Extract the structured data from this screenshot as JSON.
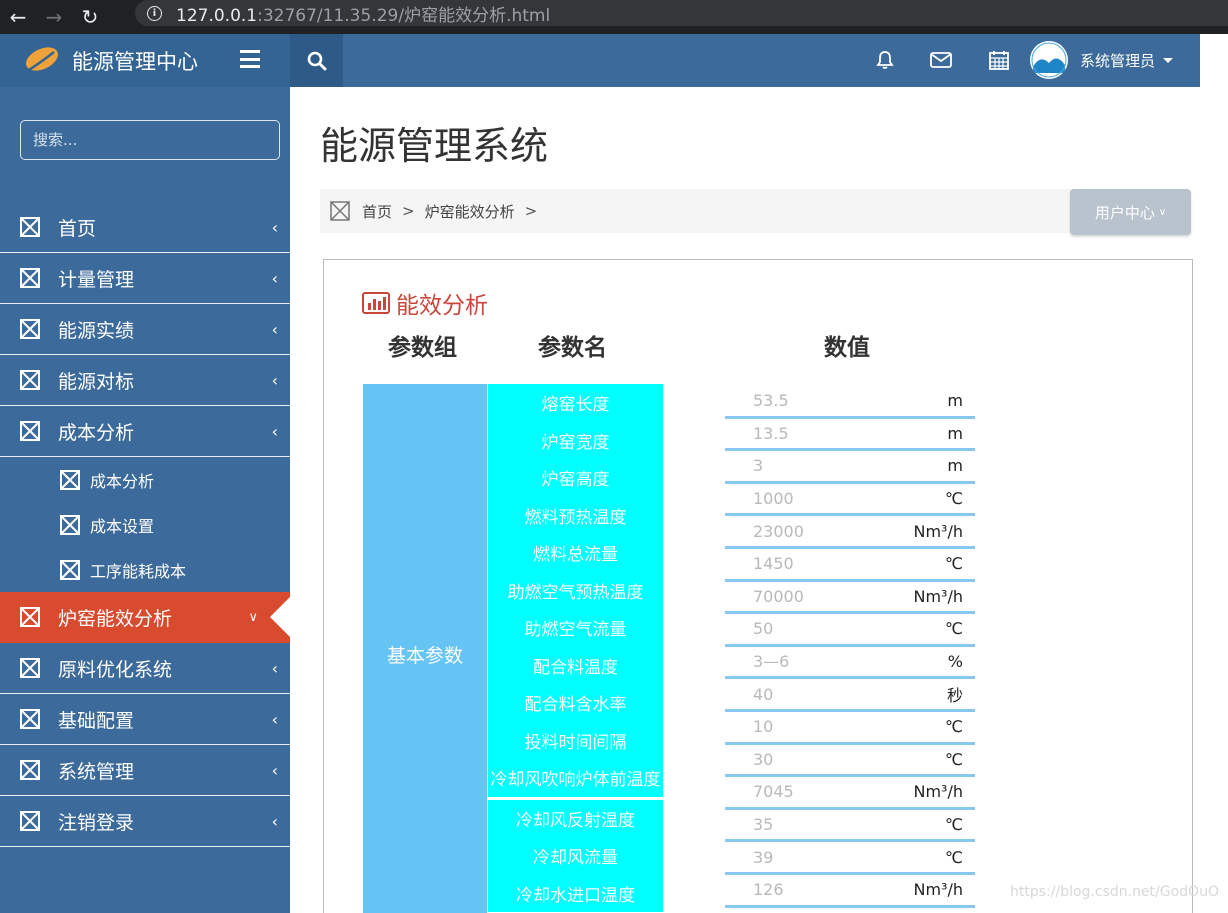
{
  "browser": {
    "url_host": "127.0.0.1",
    "url_rest": ":32767/11.35.29/炉窑能效分析.html"
  },
  "header": {
    "app_name": "能源管理中心",
    "user_name": "系统管理员"
  },
  "sidebar": {
    "search_placeholder": "搜索...",
    "items": [
      {
        "label": "首页"
      },
      {
        "label": "计量管理"
      },
      {
        "label": "能源实绩"
      },
      {
        "label": "能源对标"
      },
      {
        "label": "成本分析"
      },
      {
        "label": "炉窑能效分析"
      },
      {
        "label": "原料优化系统"
      },
      {
        "label": "基础配置"
      },
      {
        "label": "系统管理"
      },
      {
        "label": "注销登录"
      }
    ],
    "subitems": [
      {
        "label": "成本分析"
      },
      {
        "label": "成本设置"
      },
      {
        "label": "工序能耗成本"
      }
    ]
  },
  "main": {
    "page_title": "能源管理系统",
    "breadcrumb": [
      "首页",
      "炉窑能效分析"
    ],
    "user_center_label": "用户中心"
  },
  "panel": {
    "title": "能效分析",
    "col_group": "参数组",
    "col_name": "参数名",
    "col_value": "数值",
    "group_label": "基本参数",
    "params": [
      {
        "name": "熔窑长度",
        "value": "53.5",
        "unit": "m"
      },
      {
        "name": "炉窑宽度",
        "value": "13.5",
        "unit": "m"
      },
      {
        "name": "炉窑高度",
        "value": "3",
        "unit": "m"
      },
      {
        "name": "燃料预热温度",
        "value": "1000",
        "unit": "℃"
      },
      {
        "name": "燃料总流量",
        "value": "23000",
        "unit": "Nm³/h"
      },
      {
        "name": "助燃空气预热温度",
        "value": "1450",
        "unit": "℃"
      },
      {
        "name": "助燃空气流量",
        "value": "70000",
        "unit": "Nm³/h"
      },
      {
        "name": "配合料温度",
        "value": "50",
        "unit": "℃"
      },
      {
        "name": "配合料含水率",
        "value": "3—6",
        "unit": "%"
      },
      {
        "name": "投料时间间隔",
        "value": "40",
        "unit": "秒"
      },
      {
        "name": "冷却风吹响炉体前温度",
        "value": "10",
        "unit": "℃"
      },
      {
        "name": "冷却风反射温度",
        "value": "30",
        "unit": "℃"
      },
      {
        "name": "冷却风流量",
        "value": "7045",
        "unit": "Nm³/h"
      },
      {
        "name": "冷却水进口温度",
        "value": "35",
        "unit": "℃"
      },
      {
        "name": "",
        "value": "39",
        "unit": "℃"
      },
      {
        "name": "",
        "value": "126",
        "unit": "Nm³/h"
      }
    ]
  },
  "watermark": "https://blog.csdn.net/GodOuO"
}
